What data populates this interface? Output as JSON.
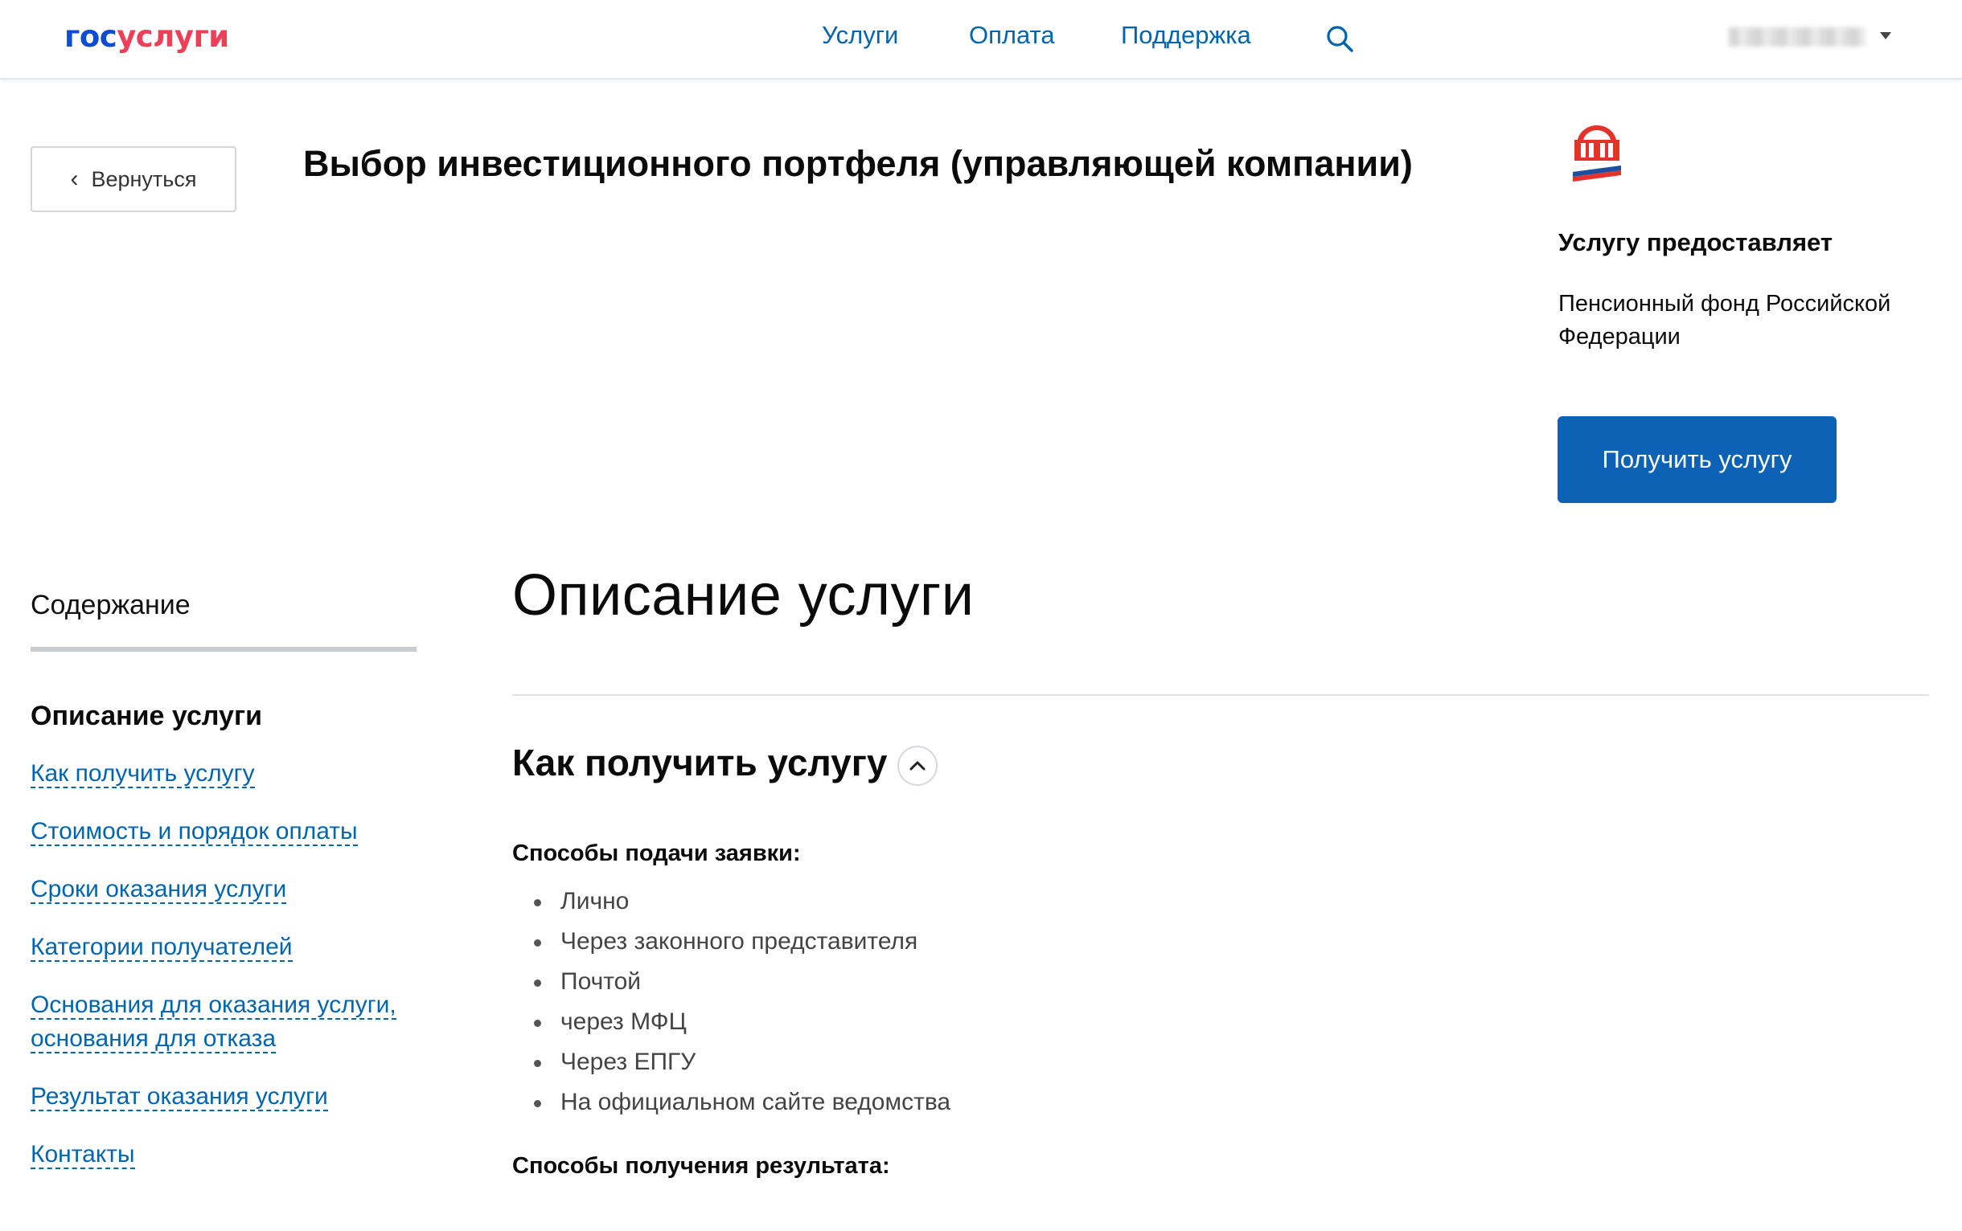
{
  "header": {
    "logo": {
      "part1": "гос",
      "part2": "услуги"
    },
    "nav": [
      "Услуги",
      "Оплата",
      "Поддержка"
    ]
  },
  "back_button": {
    "label": "Вернуться"
  },
  "page_title": "Выбор инвестиционного портфеля (управляющей компании)",
  "provider": {
    "heading": "Услугу предоставляет",
    "name": "Пенсионный фонд Российской Федерации",
    "button": "Получить услугу"
  },
  "toc": {
    "title": "Содержание",
    "active": "Описание услуги",
    "links": [
      "Как получить услугу",
      "Стоимость и порядок оплаты",
      "Сроки оказания услуги",
      "Категории получателей",
      "Основания для оказания услуги, основания для отказа",
      "Результат оказания услуги",
      "Контакты"
    ]
  },
  "main": {
    "heading": "Описание услуги",
    "section_title": "Как получить услугу",
    "submission_title": "Способы подачи заявки:",
    "submission_methods": [
      "Лично",
      "Через законного представителя",
      "Почтой",
      "через МФЦ",
      "Через ЕПГУ",
      "На официальном сайте ведомства"
    ],
    "result_title": "Способы получения результата:"
  },
  "colors": {
    "brand_blue": "#0d4cd3",
    "brand_red": "#ee3f58",
    "link": "#0065b1",
    "primary_button": "#0d62b6"
  }
}
